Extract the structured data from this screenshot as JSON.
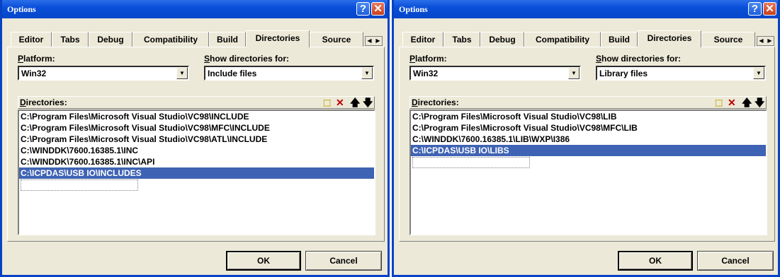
{
  "dialogs": [
    {
      "title": "Options",
      "tabs": [
        "Editor",
        "Tabs",
        "Debug",
        "Compatibility",
        "Build",
        "Directories",
        "Source"
      ],
      "active_tab": "Directories",
      "platform_label_u": "P",
      "platform_label_rest": "latform:",
      "platform_value": "Win32",
      "show_dirs_label_u": "S",
      "show_dirs_label_rest": "how directories for:",
      "show_dirs_value": "Include files",
      "dirs_label_u": "D",
      "dirs_label_rest": "irectories:",
      "directories": [
        "C:\\Program Files\\Microsoft Visual Studio\\VC98\\INCLUDE",
        "C:\\Program Files\\Microsoft Visual Studio\\VC98\\MFC\\INCLUDE",
        "C:\\Program Files\\Microsoft Visual Studio\\VC98\\ATL\\INCLUDE",
        "C:\\WINDDK\\7600.16385.1\\INC",
        "C:\\WINDDK\\7600.16385.1\\INC\\API",
        "C:\\ICPDAS\\USB IO\\INCLUDES"
      ],
      "selected_index": 5,
      "ok_label": "OK",
      "cancel_label": "Cancel"
    },
    {
      "title": "Options",
      "tabs": [
        "Editor",
        "Tabs",
        "Debug",
        "Compatibility",
        "Build",
        "Directories",
        "Source"
      ],
      "active_tab": "Directories",
      "platform_label_u": "P",
      "platform_label_rest": "latform:",
      "platform_value": "Win32",
      "show_dirs_label_u": "S",
      "show_dirs_label_rest": "how directories for:",
      "show_dirs_value": "Library files",
      "dirs_label_u": "D",
      "dirs_label_rest": "irectories:",
      "directories": [
        "C:\\Program Files\\Microsoft Visual Studio\\VC98\\LIB",
        "C:\\Program Files\\Microsoft Visual Studio\\VC98\\MFC\\LIB",
        "C:\\WINDDK\\7600.16385.1\\LIB\\WXP\\I386",
        "C:\\ICPDAS\\USB IO\\LIBS"
      ],
      "selected_index": 3,
      "ok_label": "OK",
      "cancel_label": "Cancel"
    }
  ],
  "icons": {
    "help": "?",
    "close": "✕",
    "new_dir": "new-folder-icon",
    "delete": "delete-icon",
    "move_up": "arrow-up-icon",
    "move_down": "arrow-down-icon"
  },
  "colors": {
    "titlebar": "#0a4fd9",
    "selection": "#3f63b4",
    "dialog_bg": "#ece9d8",
    "delete_icon": "#c00000"
  }
}
